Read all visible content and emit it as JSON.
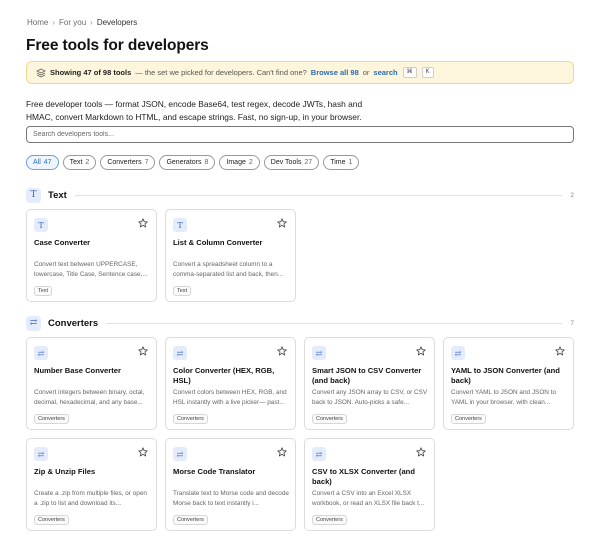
{
  "breadcrumb": {
    "home": "Home",
    "for_you": "For you",
    "current": "Developers",
    "sep": "›"
  },
  "page_title": "Free tools for developers",
  "notice": {
    "showing": "Showing 47 of 98 tools",
    "text": "— the set we picked for developers. Can't find one?",
    "browse_all": "Browse all 98",
    "or": "or",
    "search": "search",
    "kbd1": "⌘",
    "kbd2": "K"
  },
  "description": "Free developer tools — format JSON, encode Base64, test regex, decode JWTs, hash and HMAC, convert Markdown to HTML, and escape strings. Fast, no sign-up, in your browser.",
  "search": {
    "placeholder": "Search developers tools..."
  },
  "filters": [
    {
      "label": "All",
      "count": "47"
    },
    {
      "label": "Text",
      "count": "2"
    },
    {
      "label": "Converters",
      "count": "7"
    },
    {
      "label": "Generators",
      "count": "8"
    },
    {
      "label": "Image",
      "count": "2"
    },
    {
      "label": "Dev Tools",
      "count": "27"
    },
    {
      "label": "Time",
      "count": "1"
    }
  ],
  "sections": {
    "text": {
      "title": "Text",
      "count": "2",
      "icon": "T",
      "cards": [
        {
          "title": "Case Converter",
          "text": "Convert text between UPPERCASE, lowercase, Title Case, Sentence case,...",
          "tag": "Text",
          "icon": "T"
        },
        {
          "title": "List & Column Converter",
          "text": "Convert a spreadsheet column to a comma-separated list and back, then...",
          "tag": "Text",
          "icon": "T"
        }
      ]
    },
    "converters": {
      "title": "Converters",
      "count": "7",
      "icon": "⇄",
      "cards": [
        {
          "title": "Number Base Converter",
          "text": "Convert integers between binary, octal, decimal, hexadecimal, and any base...",
          "tag": "Converters",
          "icon": "⇄"
        },
        {
          "title": "Color Converter (HEX, RGB, HSL)",
          "text": "Convert colors between HEX, RGB, and HSL instantly with a live picker— past...",
          "tag": "Converters",
          "icon": "⇄"
        },
        {
          "title": "Smart JSON to CSV Converter (and back)",
          "text": "Convert any JSON array to CSV, or CSV back to JSON. Auto-picks a safe...",
          "tag": "Converters",
          "icon": "⇄"
        },
        {
          "title": "YAML to JSON Converter (and back)",
          "text": "Convert YAML to JSON and JSON to YAML in your browser, with clean...",
          "tag": "Converters",
          "icon": "⇄"
        },
        {
          "title": "Zip & Unzip Files",
          "text": "Create a .zip from multiple files, or open a .zip to list and download its...",
          "tag": "Converters",
          "icon": "⇄"
        },
        {
          "title": "Morse Code Translator",
          "text": "Translate text to Morse code and decode Morse back to text instantly i...",
          "tag": "Converters",
          "icon": "⇄"
        },
        {
          "title": "CSV to XLSX Converter (and back)",
          "text": "Convert a CSV into an Excel XLSX workbook, or read an XLSX file back t...",
          "tag": "Converters",
          "icon": "⇄"
        }
      ]
    }
  }
}
